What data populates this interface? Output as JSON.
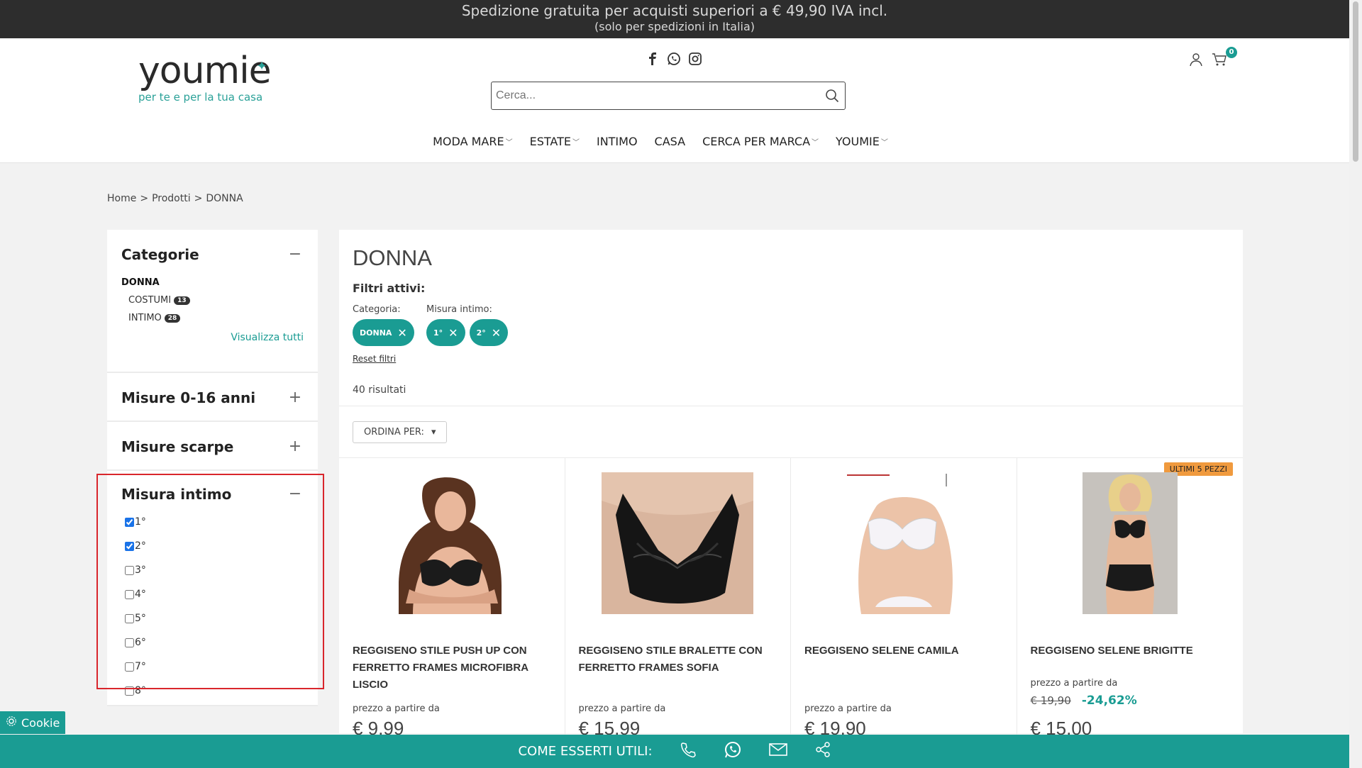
{
  "topbar": {
    "line1": "Spedizione gratuita per acquisti superiori a € 49,90 IVA incl.",
    "line2": "(solo per spedizioni in Italia)"
  },
  "header": {
    "logo_word": "youmie",
    "logo_tagline": "per te e per la tua casa",
    "search_placeholder": "Cerca...",
    "cart_count": "0"
  },
  "nav": [
    {
      "label": "MODA MARE",
      "dropdown": true
    },
    {
      "label": "ESTATE",
      "dropdown": true
    },
    {
      "label": "INTIMO",
      "dropdown": false
    },
    {
      "label": "CASA",
      "dropdown": false
    },
    {
      "label": "CERCA PER MARCA",
      "dropdown": true
    },
    {
      "label": "YOUMIE",
      "dropdown": true
    }
  ],
  "breadcrumb": [
    "Home",
    "Prodotti",
    "DONNA"
  ],
  "sidebar": {
    "categorie": {
      "title": "Categorie",
      "toggle": "−",
      "root": "DONNA",
      "children": [
        {
          "label": "COSTUMI",
          "count": "13"
        },
        {
          "label": "INTIMO",
          "count": "28"
        }
      ],
      "view_all": "Visualizza tutti"
    },
    "misure_anni": {
      "title": "Misure 0-16 anni",
      "toggle": "+"
    },
    "misure_scarpe": {
      "title": "Misure scarpe",
      "toggle": "+"
    },
    "misura_intimo": {
      "title": "Misura intimo",
      "toggle": "−",
      "options": [
        {
          "label": "1°",
          "checked": true
        },
        {
          "label": "2°",
          "checked": true
        },
        {
          "label": "3°",
          "checked": false
        },
        {
          "label": "4°",
          "checked": false
        },
        {
          "label": "5°",
          "checked": false
        },
        {
          "label": "6°",
          "checked": false
        },
        {
          "label": "7°",
          "checked": false
        },
        {
          "label": "8°",
          "checked": false
        }
      ]
    }
  },
  "main": {
    "title": "DONNA",
    "active_filters_title": "Filtri attivi:",
    "filter_groups": [
      {
        "label": "Categoria:",
        "chips": [
          "DONNA"
        ]
      },
      {
        "label": "Misura intimo:",
        "chips": [
          "1°",
          "2°"
        ]
      }
    ],
    "reset": "Reset filtri",
    "results": "40 risultati",
    "sort_label": "ORDINA PER:"
  },
  "products": [
    {
      "name": "REGGISENO STILE PUSH UP CON FERRETTO FRAMES MICROFIBRA LISCIO",
      "from": "prezzo a partire da",
      "price": "€ 9,99"
    },
    {
      "name": "REGGISENO STILE BRALETTE CON FERRETTO FRAMES SOFIA",
      "from": "prezzo a partire da",
      "price": "€ 15,99"
    },
    {
      "name": "REGGISENO SELENE CAMILA",
      "from": "prezzo a partire da",
      "price": "€ 19,90"
    },
    {
      "name": "REGGISENO SELENE BRIGITTE",
      "from": "prezzo a partire da",
      "price": "€ 15,00",
      "old_price": "€ 19,90",
      "discount": "-24,62%",
      "badge": "ULTIMI 5 PEZZI"
    }
  ],
  "footer": {
    "label": "COME ESSERTI UTILI:"
  },
  "cookie": {
    "label": "Cookie"
  },
  "colors": {
    "accent": "#1a9c93",
    "topbar": "#2d2d2d",
    "highlight_box": "#d9262c",
    "badge": "#f09a3e"
  }
}
